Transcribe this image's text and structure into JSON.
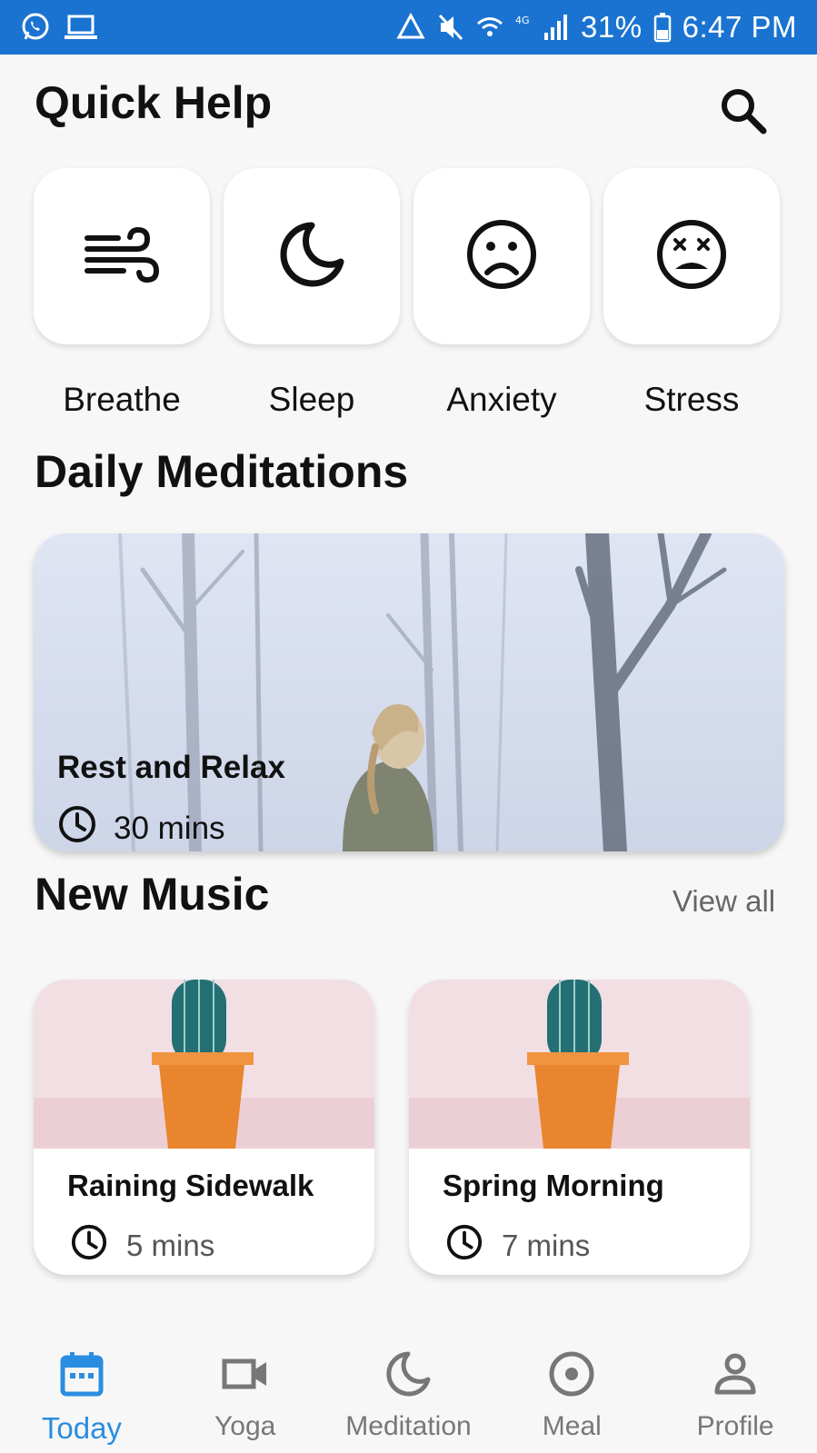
{
  "status_bar": {
    "battery": "31%",
    "time": "6:47 PM"
  },
  "header": {
    "title": "Quick Help"
  },
  "quick_help": [
    {
      "label": "Breathe",
      "icon": "wind-icon"
    },
    {
      "label": "Sleep",
      "icon": "moon-icon"
    },
    {
      "label": "Anxiety",
      "icon": "sad-face-icon"
    },
    {
      "label": "Stress",
      "icon": "stressed-face-icon"
    }
  ],
  "daily": {
    "section_title": "Daily Meditations",
    "card": {
      "title": "Rest and Relax",
      "duration": "30 mins"
    }
  },
  "music": {
    "section_title": "New Music",
    "view_all": "View all",
    "items": [
      {
        "title": "Raining Sidewalk",
        "duration": "5 mins"
      },
      {
        "title": "Spring Morning",
        "duration": "7 mins"
      }
    ]
  },
  "bottom_nav": {
    "items": [
      {
        "label": "Today",
        "icon": "calendar-icon",
        "active": true
      },
      {
        "label": "Yoga",
        "icon": "video-camera-icon",
        "active": false
      },
      {
        "label": "Meditation",
        "icon": "moon-icon",
        "active": false
      },
      {
        "label": "Meal",
        "icon": "target-icon",
        "active": false
      },
      {
        "label": "Profile",
        "icon": "person-icon",
        "active": false
      }
    ]
  },
  "colors": {
    "status_bar": "#1a73d1",
    "accent": "#2b8de0",
    "background": "#f7f7f7"
  }
}
